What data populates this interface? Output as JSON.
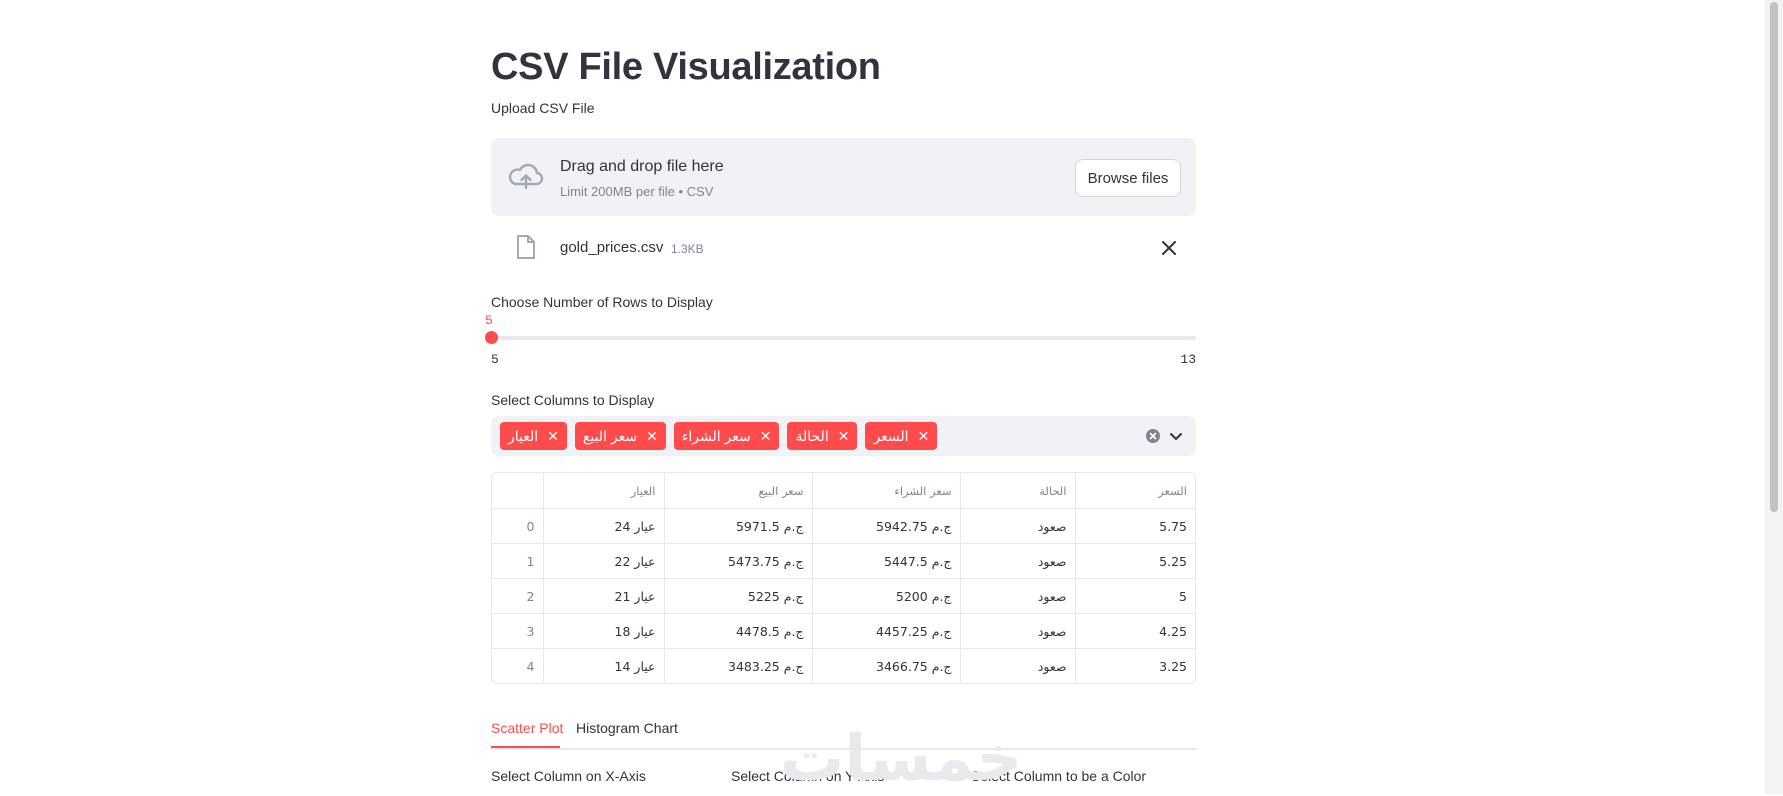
{
  "page": {
    "title": "CSV File Visualization"
  },
  "uploader": {
    "label": "Upload CSV File",
    "drag_text": "Drag and drop file here",
    "limit_text": "Limit 200MB per file • CSV",
    "browse_label": "Browse files",
    "icon": "cloud-upload-icon"
  },
  "uploaded_file": {
    "name": "gold_prices.csv",
    "size": "1.3KB",
    "icon": "file-icon"
  },
  "rows_slider": {
    "label": "Choose Number of Rows to Display",
    "value": "5",
    "min": "5",
    "max": "13"
  },
  "column_select": {
    "label": "Select Columns to Display",
    "selected": [
      "العيار",
      "سعر البيع",
      "سعر الشراء",
      "الحالة",
      "السعر"
    ]
  },
  "table": {
    "headers": [
      "",
      "العيار",
      "سعر البيع",
      "سعر الشراء",
      "الحالة",
      "السعر"
    ],
    "rows": [
      [
        "0",
        "عيار 24",
        "5971.5 ج.م",
        "5942.75 ج.م",
        "صعود",
        "5.75"
      ],
      [
        "1",
        "عيار 22",
        "5473.75 ج.م",
        "5447.5 ج.م",
        "صعود",
        "5.25"
      ],
      [
        "2",
        "عيار 21",
        "5225 ج.م",
        "5200 ج.م",
        "صعود",
        "5"
      ],
      [
        "3",
        "عيار 18",
        "4478.5 ج.م",
        "4457.25 ج.م",
        "صعود",
        "4.25"
      ],
      [
        "4",
        "عيار 14",
        "3483.25 ج.م",
        "3466.75 ج.م",
        "صعود",
        "3.25"
      ]
    ]
  },
  "tabs": [
    {
      "label": "Scatter Plot",
      "active": true
    },
    {
      "label": "Histogram Chart",
      "active": false
    }
  ],
  "chart_selects": {
    "x_label": "Select Column on X-Axis",
    "y_label": "Select Column on Y-Axis",
    "color_label": "Select Column to be a Color"
  },
  "watermark": {
    "text": "خمسات"
  },
  "colors": {
    "accent": "#ff4b4b",
    "text": "#31333f",
    "muted": "#808495",
    "panel": "#f0f2f6"
  }
}
